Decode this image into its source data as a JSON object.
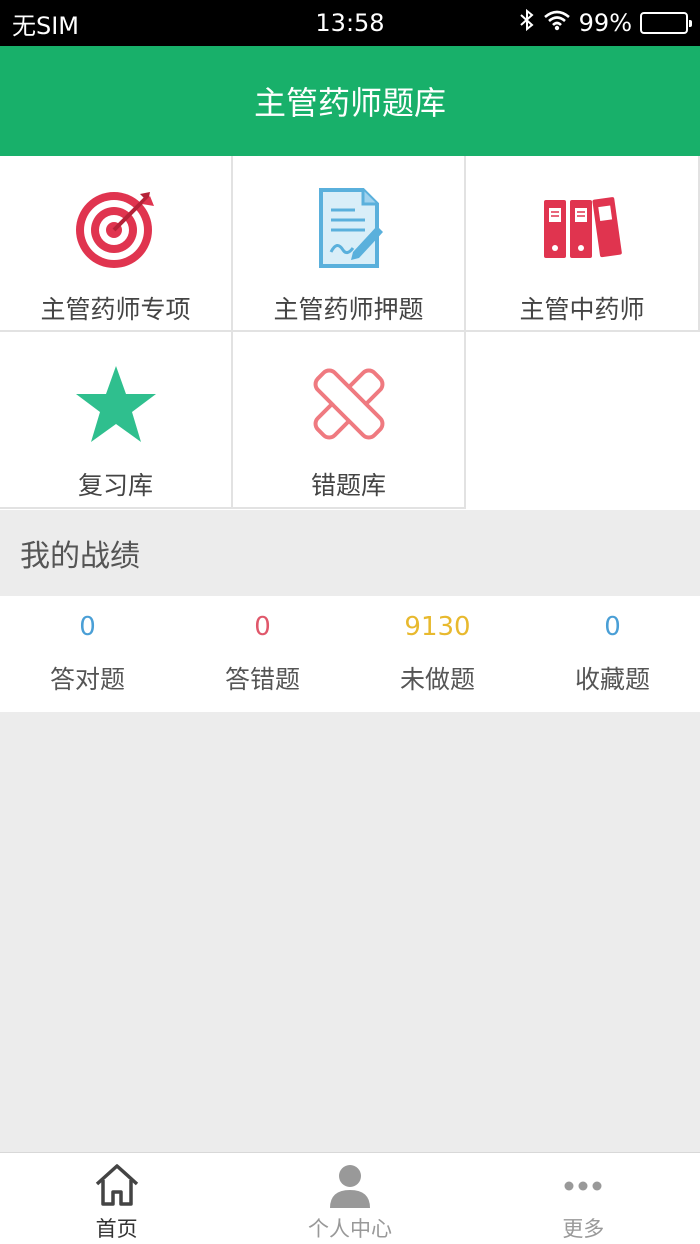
{
  "status_bar": {
    "carrier": "无SIM",
    "time": "13:58",
    "battery_text": "99%",
    "battery_level": 0.99
  },
  "header": {
    "title": "主管药师题库"
  },
  "grid": {
    "items": [
      {
        "label": "主管药师专项",
        "icon": "target-icon"
      },
      {
        "label": "主管药师押题",
        "icon": "document-pen-icon"
      },
      {
        "label": "主管中药师",
        "icon": "binders-icon"
      },
      {
        "label": "复习库",
        "icon": "star-icon"
      },
      {
        "label": "错题库",
        "icon": "x-mark-icon"
      }
    ]
  },
  "section": {
    "title": "我的战绩"
  },
  "stats": [
    {
      "value": "0",
      "label": "答对题",
      "color": "#4a9fd6"
    },
    {
      "value": "0",
      "label": "答错题",
      "color": "#e0586b"
    },
    {
      "value": "9130",
      "label": "未做题",
      "color": "#e8b92e"
    },
    {
      "value": "0",
      "label": "收藏题",
      "color": "#4a9fd6"
    }
  ],
  "tabbar": {
    "items": [
      {
        "label": "首页",
        "icon": "home-icon",
        "active": true
      },
      {
        "label": "个人中心",
        "icon": "person-icon",
        "active": false
      },
      {
        "label": "更多",
        "icon": "more-dots-icon",
        "active": false
      }
    ]
  },
  "colors": {
    "brand": "#18b06a",
    "tab_active": "#333333",
    "tab_inactive": "#999999"
  }
}
